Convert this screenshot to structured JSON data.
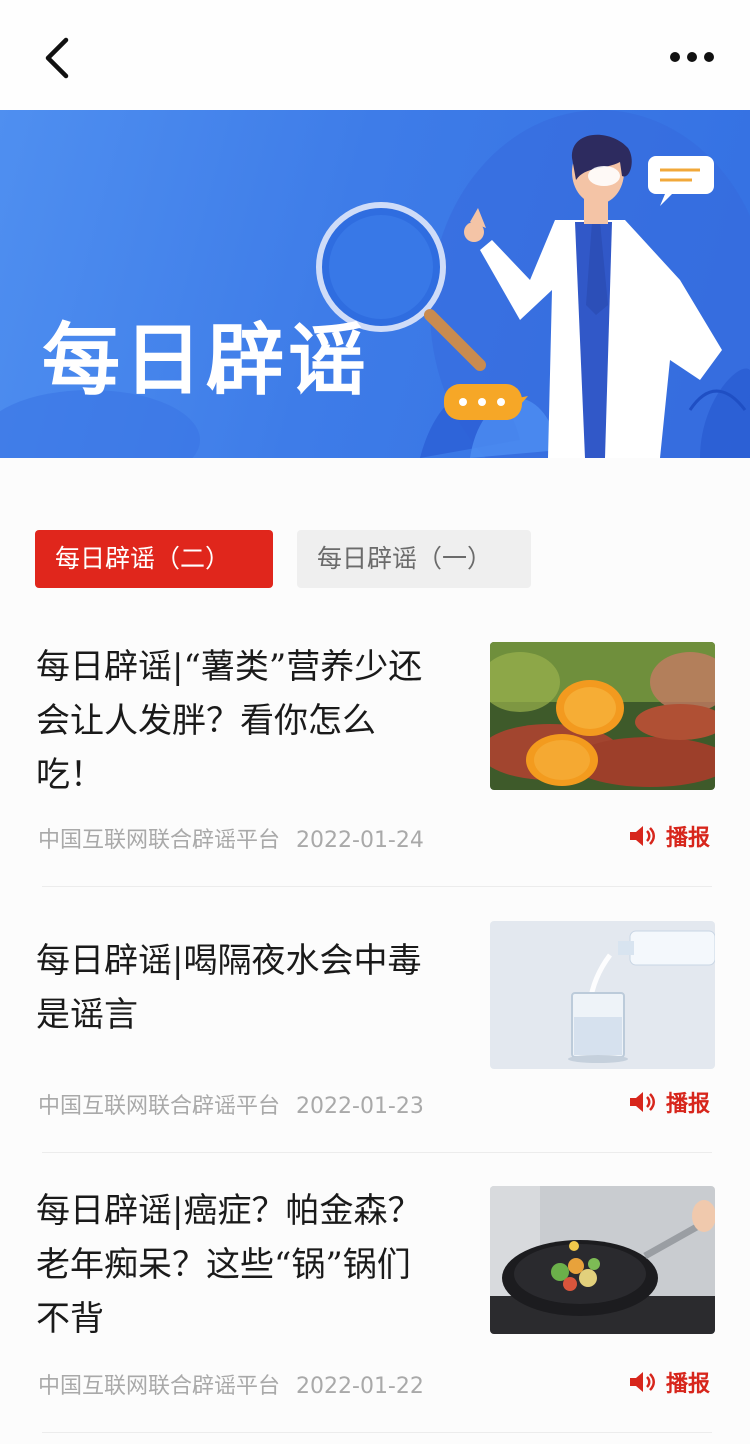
{
  "banner": {
    "title": "每日辟谣"
  },
  "tabs": [
    {
      "label": "每日辟谣（二）"
    },
    {
      "label": "每日辟谣（一）"
    }
  ],
  "articles": [
    {
      "title_lines": [
        "每日辟谣|“薯类”营养少还",
        "会让人发胖？看你怎么",
        "吃！"
      ],
      "source": "中国互联网联合辟谣平台",
      "date": "2022-01-24",
      "play_label": "播报"
    },
    {
      "title_lines": [
        "每日辟谣|喝隔夜水会中毒",
        "是谣言"
      ],
      "source": "中国互联网联合辟谣平台",
      "date": "2022-01-23",
      "play_label": "播报"
    },
    {
      "title_lines": [
        "每日辟谣|癌症？帕金森？",
        "老年痴呆？这些“锅”锅们",
        "不背"
      ],
      "source": "中国互联网联合辟谣平台",
      "date": "2022-01-22",
      "play_label": "播报"
    }
  ],
  "colors": {
    "accent": "#e0261c",
    "banner_blue": "#3e7ce8"
  },
  "icons": {
    "back": "chevron-left-icon",
    "more": "more-dots-icon",
    "play": "speaker-icon"
  }
}
